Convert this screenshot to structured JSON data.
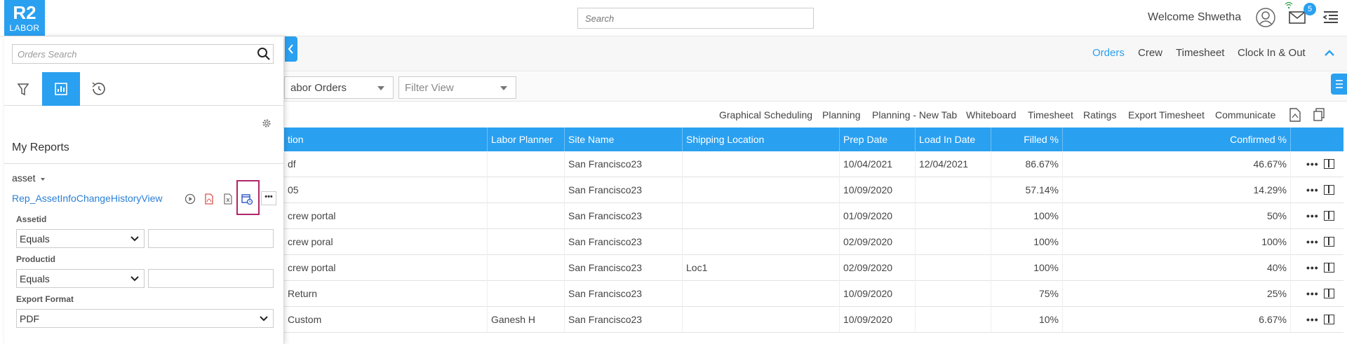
{
  "header": {
    "logo_main": "R2",
    "logo_sub": "LABOR",
    "search_placeholder": "Search",
    "welcome": "Welcome Shwetha",
    "mail_count": "5"
  },
  "nav": {
    "items": [
      "Orders",
      "Crew",
      "Timesheet",
      "Clock In & Out"
    ],
    "active": "Orders"
  },
  "filters": {
    "view_select": "abor Orders",
    "filter_view": "Filter View"
  },
  "actions": [
    "Graphical Scheduling",
    "Planning",
    "Planning - New Tab",
    "Whiteboard",
    "Timesheet",
    "Ratings",
    "Export Timesheet",
    "Communicate"
  ],
  "table": {
    "columns": [
      "tion",
      "Labor Planner",
      "Site Name",
      "Shipping Location",
      "Prep Date",
      "Load In Date",
      "Filled %",
      "Confirmed %"
    ],
    "rows": [
      [
        "df",
        "",
        "San Francisco23",
        "",
        "10/04/2021",
        "12/04/2021",
        "86.67%",
        "46.67%"
      ],
      [
        "05",
        "",
        "San Francisco23",
        "",
        "10/09/2020",
        "",
        "57.14%",
        "14.29%"
      ],
      [
        "crew portal",
        "",
        "San Francisco23",
        "",
        "01/09/2020",
        "",
        "100%",
        "50%"
      ],
      [
        "crew poral",
        "",
        "San Francisco23",
        "",
        "02/09/2020",
        "",
        "100%",
        "100%"
      ],
      [
        "crew portal",
        "",
        "San Francisco23",
        "Loc1",
        "02/09/2020",
        "",
        "100%",
        "40%"
      ],
      [
        "Return",
        "",
        "San Francisco23",
        "",
        "10/09/2020",
        "",
        "75%",
        "25%"
      ],
      [
        "Custom",
        "Ganesh H",
        "San Francisco23",
        "",
        "10/09/2020",
        "",
        "10%",
        "6.67%"
      ]
    ]
  },
  "panel": {
    "search_placeholder": "Orders Search",
    "section_title": "My Reports",
    "group_label": "asset",
    "report_name": "Rep_AssetInfoChangeHistoryView",
    "more_label": "•••",
    "fields": [
      {
        "label": "Assetid",
        "operator": "Equals"
      },
      {
        "label": "Productid",
        "operator": "Equals"
      }
    ],
    "export_label": "Export Format",
    "export_value": "PDF"
  },
  "colors": {
    "accent": "#2aa0f0",
    "highlight": "#b0266b",
    "link": "#2a7fd6"
  }
}
